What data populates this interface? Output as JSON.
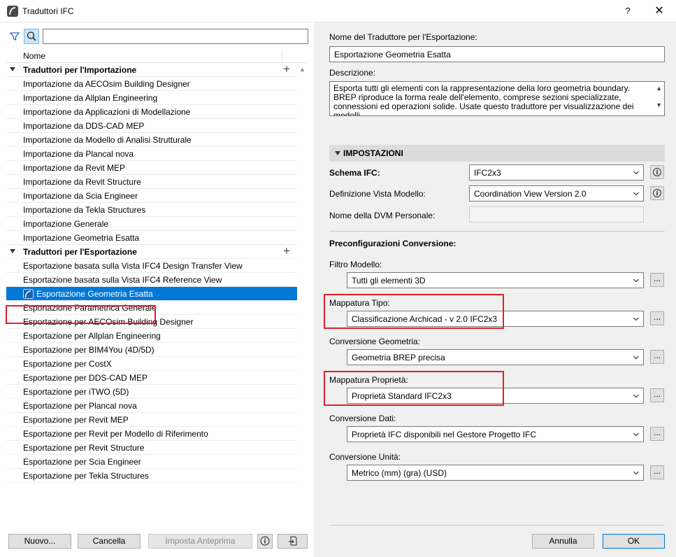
{
  "window": {
    "title": "Traduttori IFC",
    "help_label": "?",
    "close_label": "✕"
  },
  "left": {
    "search": {
      "value": "",
      "placeholder": ""
    },
    "column_header": "Nome",
    "groups": [
      {
        "label": "Traduttori per l'Importazione",
        "add_label": "+",
        "items": [
          "Importazione da AECOsim Building Designer",
          "Importazione da Allplan Engineering",
          "Importazione da Applicazioni di Modellazione",
          "Importazione da DDS-CAD MEP",
          "Importazione da Modello di Analisi Strutturale",
          "Importazione da Plancal nova",
          "Importazione da Revit MEP",
          "Importazione da Revit Structure",
          "Importazione da Scia Engineer",
          "Importazione da Tekla Structures",
          "Importazione Generale",
          "Importazione Geometria Esatta"
        ]
      },
      {
        "label": "Traduttori per l'Esportazione",
        "add_label": "+",
        "items": [
          "Esportazione basata sulla Vista IFC4 Design Transfer View",
          "Esportazione basata sulla Vista IFC4 Reference View",
          "Esportazione Geometria Esatta",
          "Esportazione Parametrica Generale",
          "Esportazione per AECOsim Building Designer",
          "Esportazione per Allplan Engineering",
          "Esportazione per BIM4You (4D/5D)",
          "Esportazione per CostX",
          "Esportazione per DDS-CAD MEP",
          "Esportazione per iTWO (5D)",
          "Esportazione per Plancal nova",
          "Esportazione per Revit MEP",
          "Esportazione per Revit per Modello di Riferimento",
          "Esportazione per Revit Structure",
          "Esportazione per Scia Engineer",
          "Esportazione per Tekla Structures"
        ]
      }
    ],
    "selected_item": "Esportazione Geometria Esatta",
    "buttons": {
      "new": "Nuovo...",
      "delete": "Cancella",
      "set_preview": "Imposta Anteprima"
    }
  },
  "right": {
    "name_label": "Nome del Traduttore per l'Esportazione:",
    "name_value": "Esportazione Geometria Esatta",
    "description_label": "Descrizione:",
    "description_value": "Esporta tutti gli elementi con la rappresentazione della loro geometria boundary. BREP riproduce la forma reale dell'elemento, comprese sezioni specializzate, connessioni ed operazioni solide. Usate questo traduttore per visualizzazione dei modelli,",
    "section_title": "IMPOSTAZIONI",
    "schema_label": "Schema IFC:",
    "schema_value": "IFC2x3",
    "mvd_label": "Definizione Vista Modello:",
    "mvd_value": "Coordination View Version 2.0",
    "custom_mvd_label": "Nome della DVM Personale:",
    "custom_mvd_value": "",
    "preconfig_label": "Preconfigurazioni Conversione:",
    "model_filter_label": "Filtro Modello:",
    "model_filter_value": "Tutti gli elementi 3D",
    "type_mapping_label": "Mappatura Tipo:",
    "type_mapping_value": "Classificazione Archicad - v 2.0 IFC2x3",
    "geometry_conv_label": "Conversione Geometria:",
    "geometry_conv_value": "Geometria BREP precisa",
    "property_mapping_label": "Mappatura Proprietà:",
    "property_mapping_value": "Proprietà Standard IFC2x3",
    "data_conv_label": "Conversione Dati:",
    "data_conv_value": "Proprietà IFC disponibili nel Gestore Progetto IFC",
    "unit_conv_label": "Conversione Unità:",
    "unit_conv_value": "Metrico (mm) (gra) (USD)",
    "dots_label": "...",
    "buttons": {
      "cancel": "Annulla",
      "ok": "OK"
    }
  },
  "colors": {
    "selection": "#0078d7",
    "highlight_box": "#e0202c",
    "panel": "#f0f0f0"
  }
}
